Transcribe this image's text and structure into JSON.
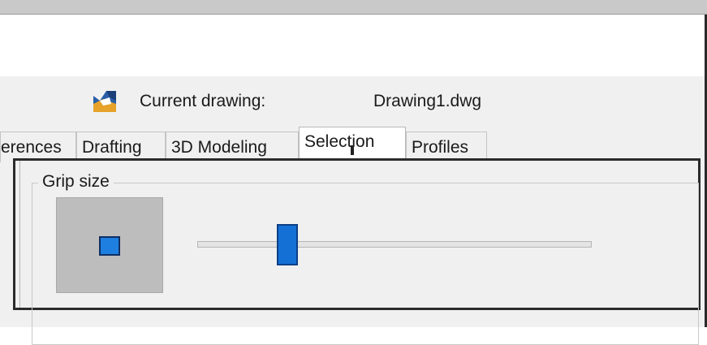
{
  "dialog": {
    "current_drawing_label": "Current drawing:",
    "current_drawing_file": "Drawing1.dwg",
    "app_icon": "autocad-drawing-icon"
  },
  "tabs": [
    {
      "label": "erences",
      "active": false
    },
    {
      "label": "Drafting",
      "active": false
    },
    {
      "label": "3D Modeling",
      "active": false
    },
    {
      "label": "Selection",
      "active": true
    },
    {
      "label": "Profiles",
      "active": false
    }
  ],
  "grip_size": {
    "title": "Grip size",
    "slider_value_fraction": 0.22,
    "grip_color": "#1e7fe0",
    "preview_bg": "#bdbdbd"
  }
}
